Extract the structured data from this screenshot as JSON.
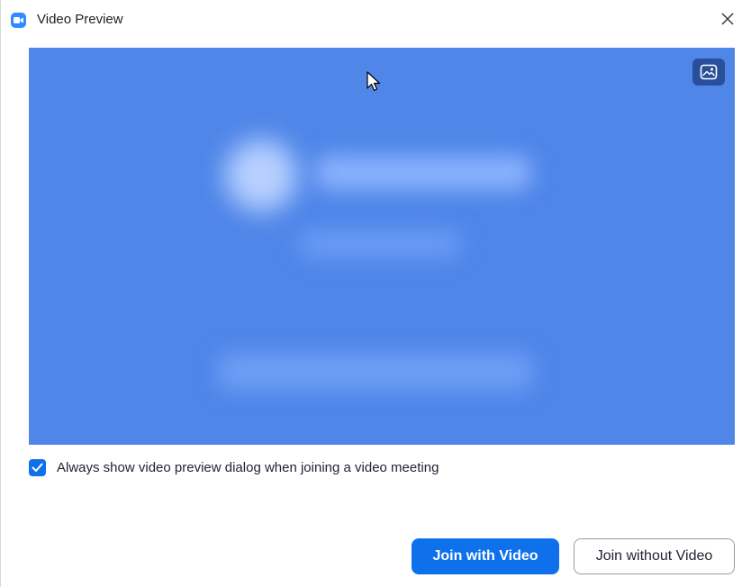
{
  "window": {
    "title": "Video Preview"
  },
  "preview": {
    "background_color": "#4f86e8",
    "background_button_icon": "image-icon"
  },
  "options": {
    "always_show_label": "Always show video preview dialog when joining a video meeting",
    "always_show_checked": true
  },
  "actions": {
    "join_with_video_label": "Join with Video",
    "join_without_video_label": "Join without Video"
  },
  "colors": {
    "accent": "#0e71eb",
    "app_icon": "#2D8CFF"
  }
}
